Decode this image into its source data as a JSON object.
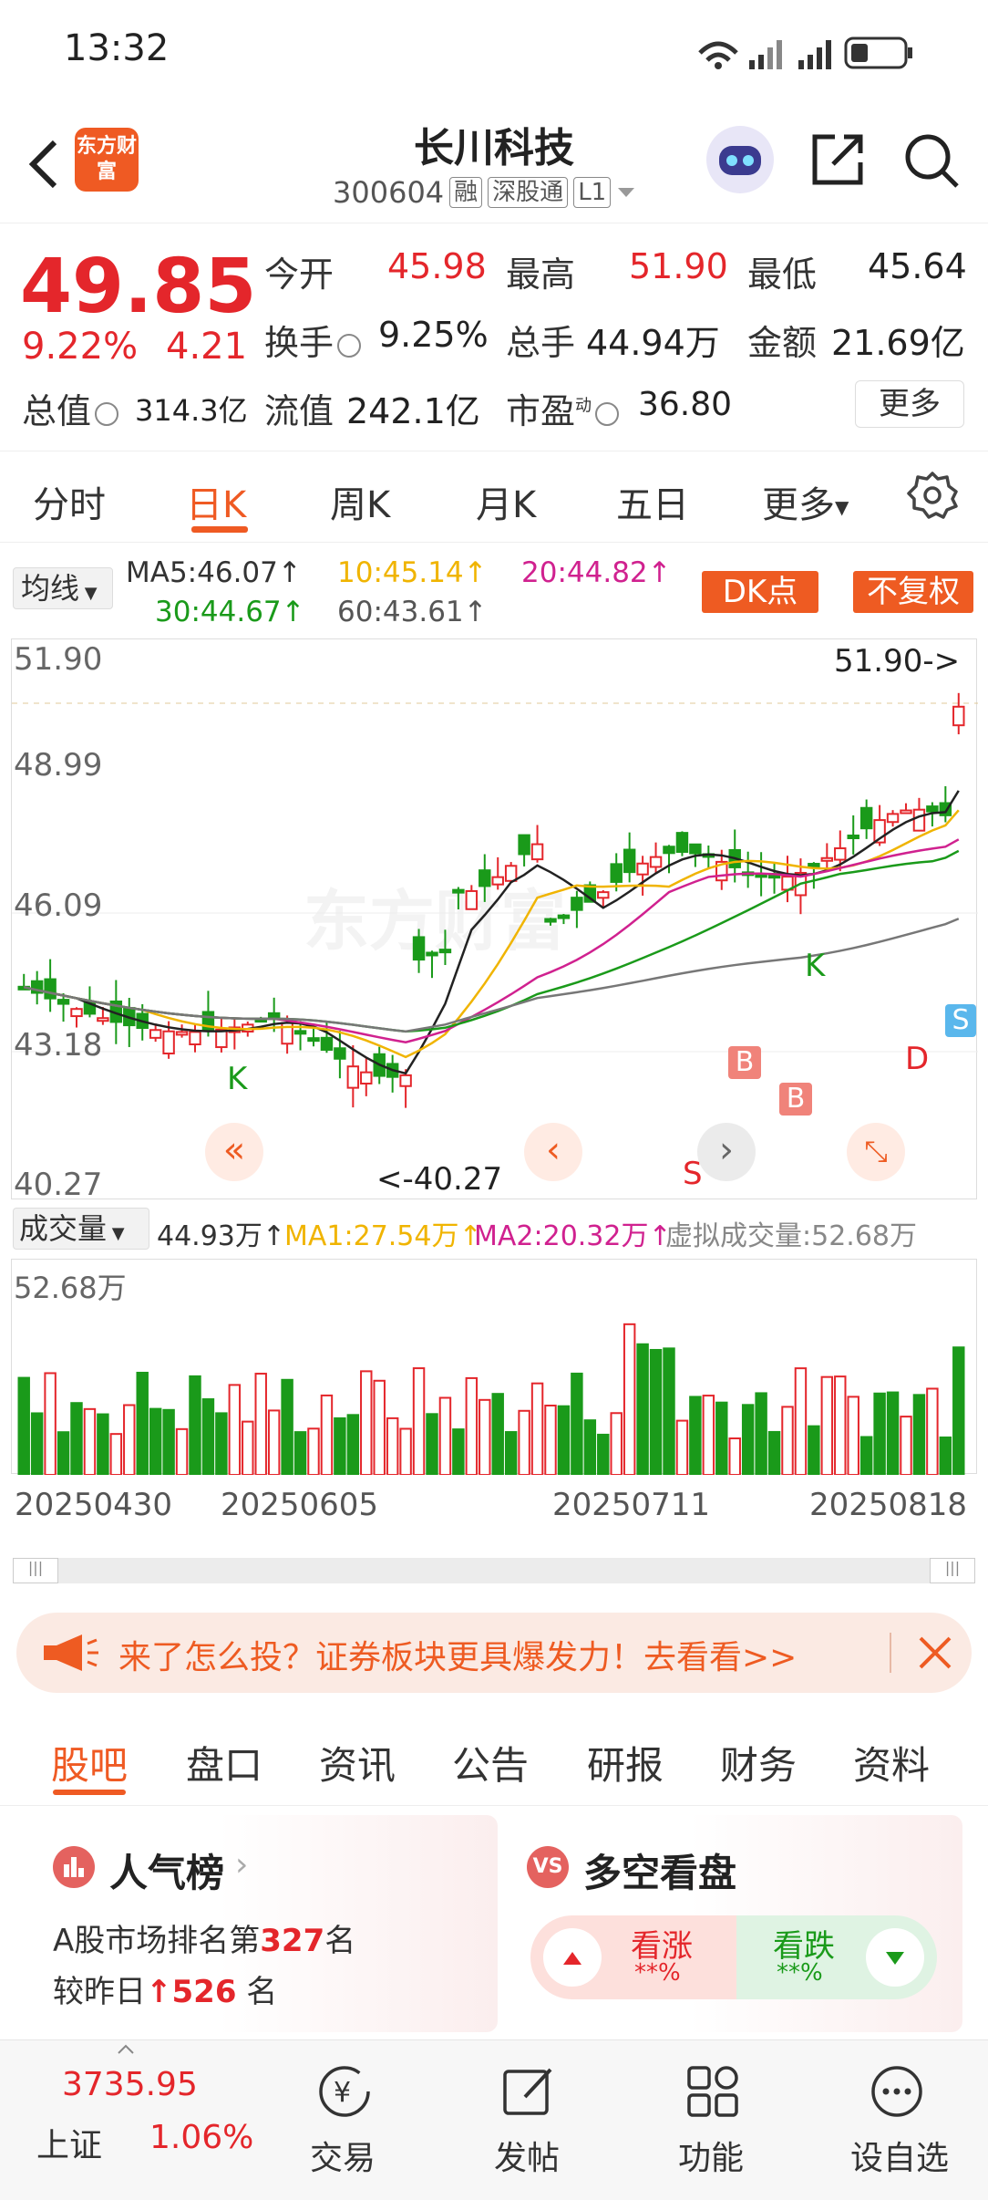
{
  "status": {
    "time": "13:32"
  },
  "header": {
    "name": "长川科技",
    "code": "300604",
    "tags": [
      "融",
      "深股通",
      "L1"
    ],
    "logo_text": "东方财富"
  },
  "quote": {
    "price": "49.85",
    "change_pct": "9.22%",
    "change_amt": "4.21",
    "open_label": "今开",
    "open": "45.98",
    "high_label": "最高",
    "high": "51.90",
    "low_label": "最低",
    "low": "45.64",
    "turnover_label": "换手",
    "turnover": "9.25%",
    "volume_label": "总手",
    "volume": "44.94万",
    "amount_label": "金额",
    "amount": "21.69亿",
    "mktcap_label": "总值",
    "mktcap": "314.3亿",
    "float_label": "流值",
    "float": "242.1亿",
    "pe_label": "市盈",
    "pe_sup": "动",
    "pe": "36.80",
    "more": "更多"
  },
  "ktabs": [
    "分时",
    "日K",
    "周K",
    "月K",
    "五日",
    "更多"
  ],
  "ma": {
    "selector": "均线",
    "ma5": "MA5:46.07↑",
    "ma10": "10:45.14↑",
    "ma20": "20:44.82↑",
    "ma30": "30:44.67↑",
    "ma60": "60:43.61↑",
    "dk_btn": "DK点",
    "fq_btn": "不复权"
  },
  "kchart": {
    "y_labels": [
      "51.90",
      "48.99",
      "46.09",
      "43.18",
      "40.27"
    ],
    "high_marker": "51.90->",
    "low_marker": "<-40.27",
    "signals": [
      "K",
      "K",
      "B",
      "B",
      "S",
      "D",
      "S"
    ],
    "watermark": "东方财富"
  },
  "volume": {
    "selector": "成交量",
    "value": "44.93万↑",
    "ma1": "MA1:27.54万↑",
    "ma2": "MA2:20.32万↑",
    "virtual": "虚拟成交量:52.68万",
    "max_label": "52.68万",
    "dates": [
      "20250430",
      "20250605",
      "20250711",
      "20250818"
    ]
  },
  "banner": {
    "text": "来了怎么投？证券板块更具爆发力！去看看>>"
  },
  "btabs": [
    "股吧",
    "盘口",
    "资讯",
    "公告",
    "研报",
    "财务",
    "资料"
  ],
  "popularity": {
    "title": "人气榜",
    "rank_prefix": "A股市场排名第",
    "rank": "327",
    "rank_suffix": "名",
    "change_prefix": "较昨日",
    "change": "526",
    "change_suffix": "名"
  },
  "sentiment": {
    "title": "多空看盘",
    "up_label": "看涨",
    "up_val": "**%",
    "down_label": "看跌",
    "down_val": "**%"
  },
  "nav": {
    "index_value": "3735.95",
    "index_name": "上证",
    "index_pct": "1.06%",
    "items": [
      "交易",
      "发帖",
      "功能",
      "设自选"
    ]
  },
  "colors": {
    "up": "#e4262b",
    "down": "#1a9a1a",
    "accent": "#ef5a23"
  }
}
